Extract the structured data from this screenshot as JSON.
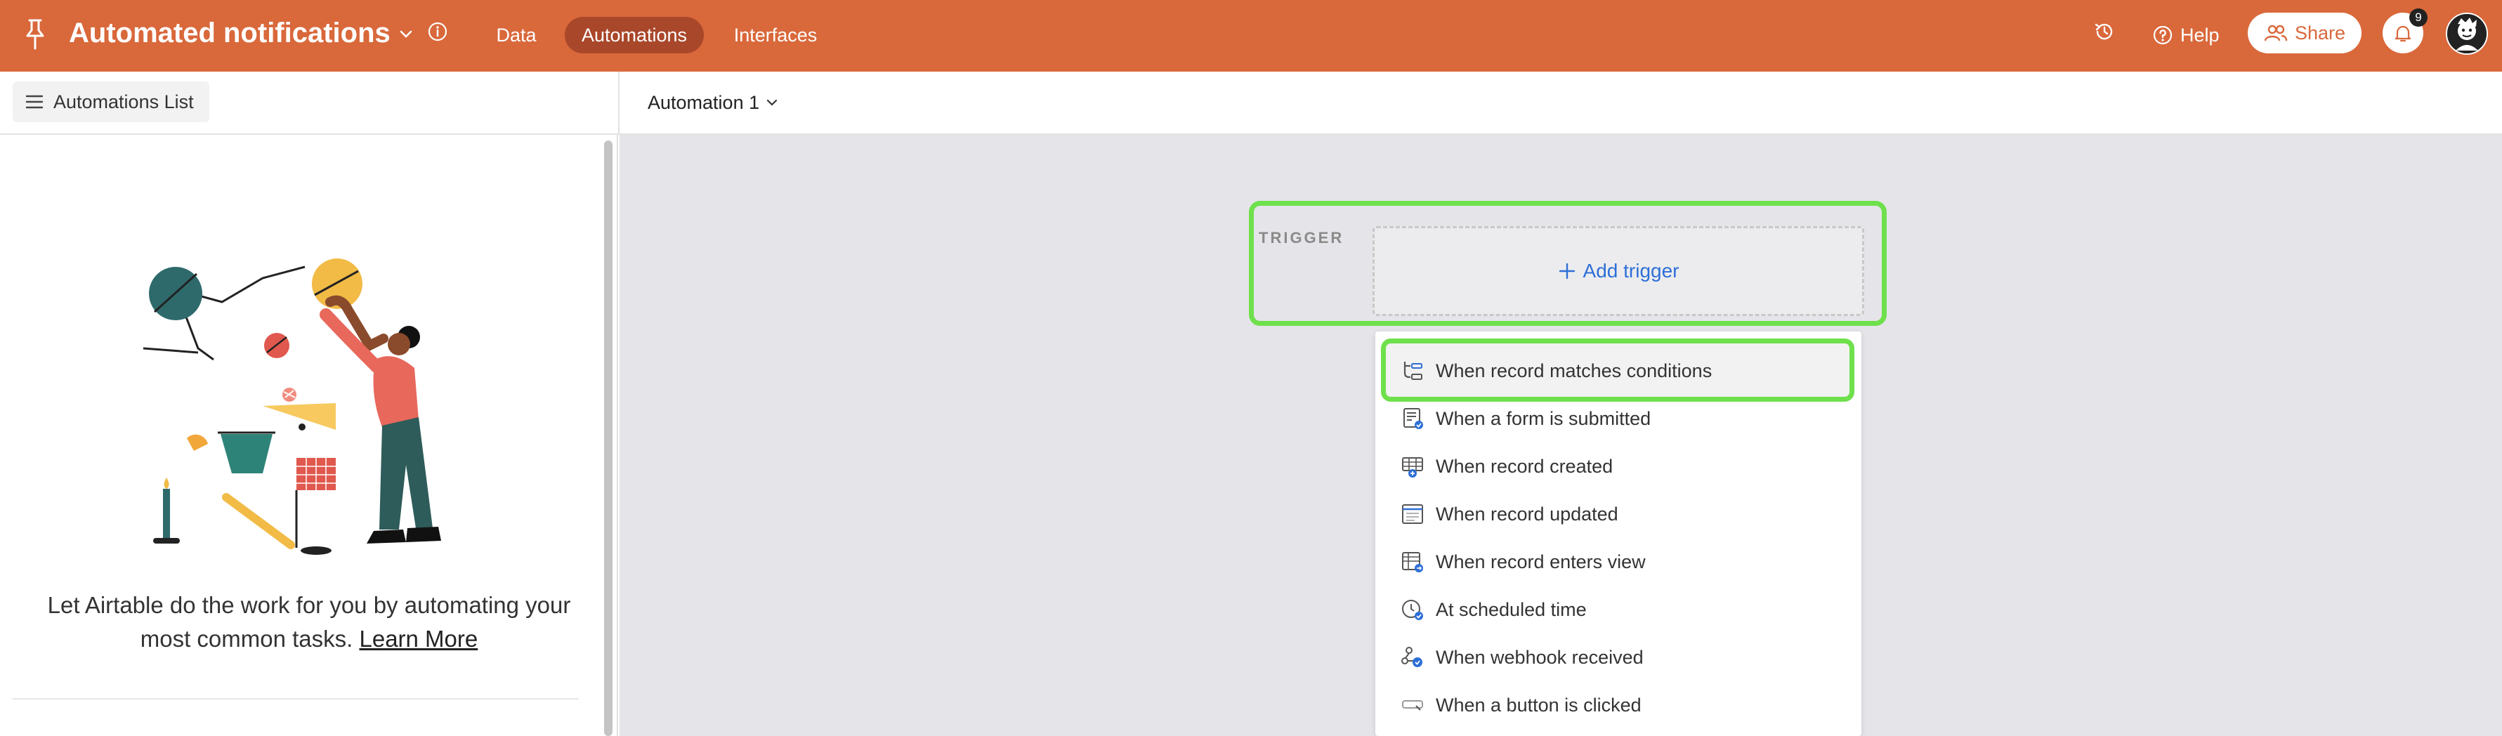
{
  "header": {
    "base_title": "Automated notifications",
    "nav": [
      "Data",
      "Automations",
      "Interfaces"
    ],
    "help_label": "Help",
    "share_label": "Share",
    "notification_count": "9",
    "brand_color": "#d9683b",
    "active_tab_color": "#a9472a"
  },
  "subbar": {
    "automations_list_label": "Automations List",
    "automation_name": "Automation 1"
  },
  "sidebar": {
    "empty_message": "Let Airtable do the work for you by automating your most common tasks.",
    "learn_more": "Learn More"
  },
  "trigger": {
    "section_label": "TRIGGER",
    "add_trigger_label": "Add trigger",
    "highlight_color": "#6ee04b",
    "options": [
      {
        "label": "When record matches conditions",
        "icon": "record-conditions-icon"
      },
      {
        "label": "When a form is submitted",
        "icon": "form-submitted-icon"
      },
      {
        "label": "When record created",
        "icon": "record-created-icon"
      },
      {
        "label": "When record updated",
        "icon": "record-updated-icon"
      },
      {
        "label": "When record enters view",
        "icon": "record-enters-view-icon"
      },
      {
        "label": "At scheduled time",
        "icon": "clock-icon"
      },
      {
        "label": "When webhook received",
        "icon": "webhook-icon"
      },
      {
        "label": "When a button is clicked",
        "icon": "button-icon"
      }
    ]
  }
}
